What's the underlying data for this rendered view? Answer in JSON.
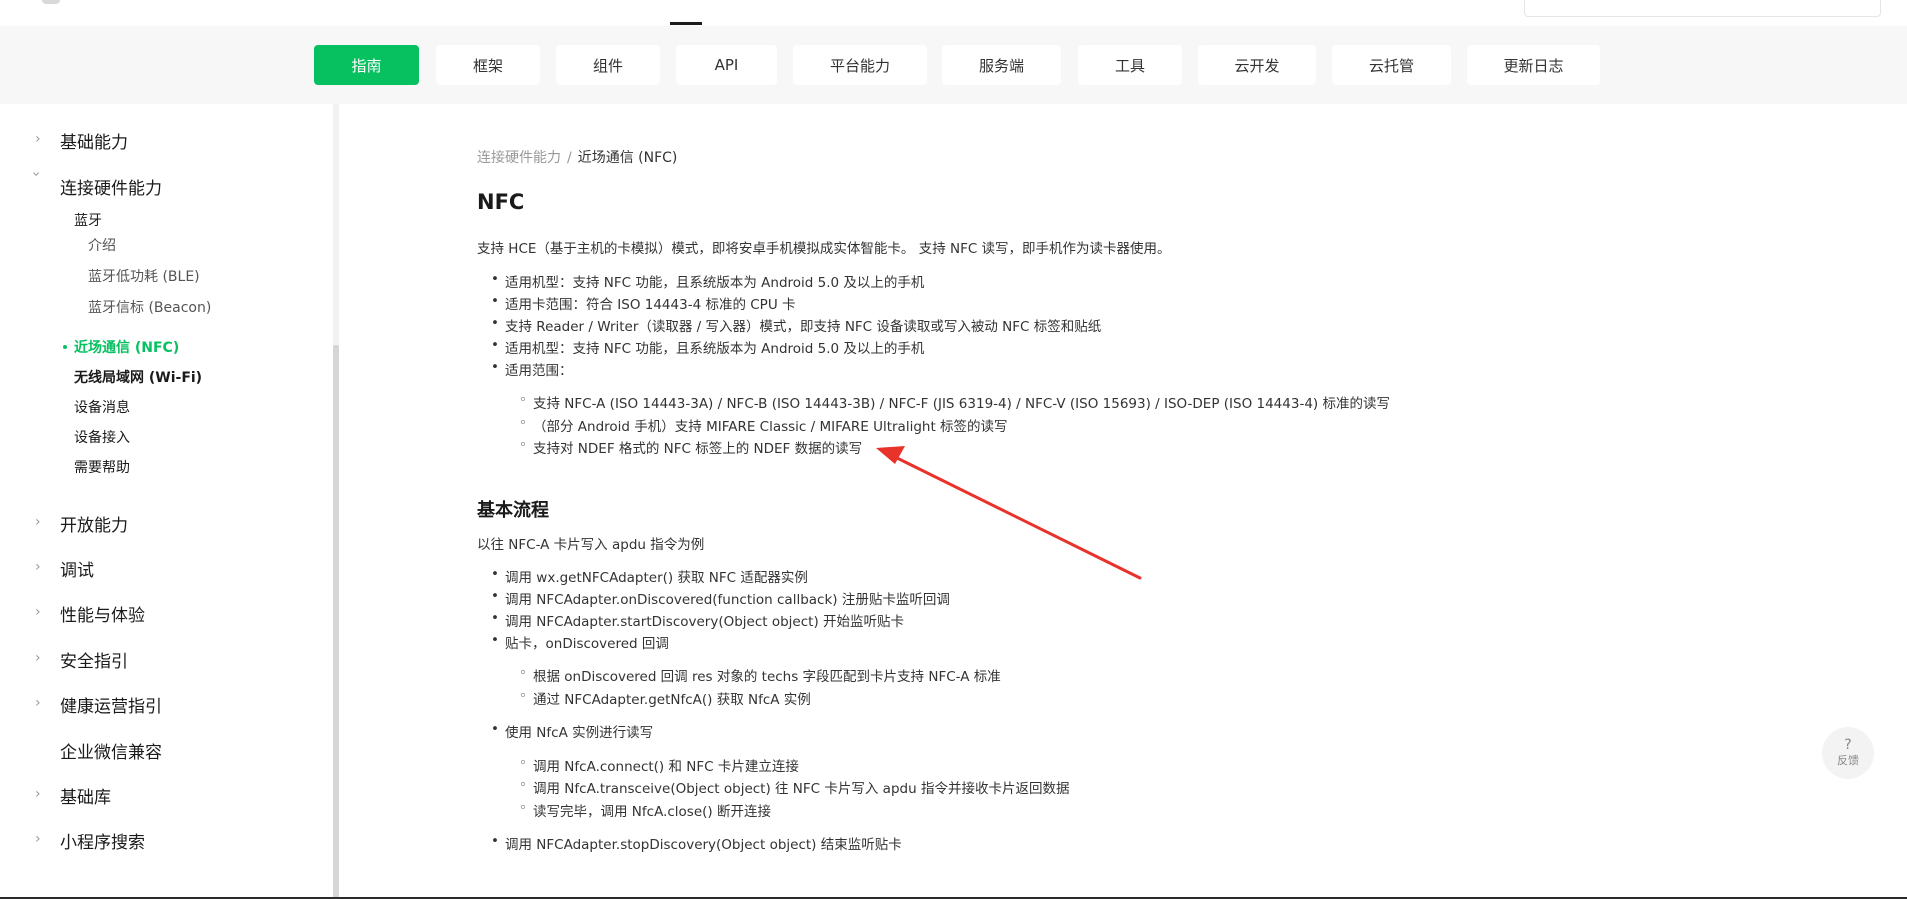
{
  "categories": [
    "指南",
    "框架",
    "组件",
    "API",
    "平台能力",
    "服务端",
    "工具",
    "云开发",
    "云托管",
    "更新日志"
  ],
  "sidebar": {
    "basic": "基础能力",
    "hardware": "连接硬件能力",
    "bluetooth": "蓝牙",
    "bt_intro": "介绍",
    "bt_ble": "蓝牙低功耗 (BLE)",
    "bt_beacon": "蓝牙信标 (Beacon)",
    "nfc": "近场通信 (NFC)",
    "wifi": "无线局域网 (Wi-Fi)",
    "device_msg": "设备消息",
    "device_access": "设备接入",
    "help": "需要帮助",
    "open": "开放能力",
    "debug": "调试",
    "perf": "性能与体验",
    "security": "安全指引",
    "health": "健康运营指引",
    "wecom": "企业微信兼容",
    "lib": "基础库",
    "search": "小程序搜索"
  },
  "breadcrumb": {
    "parent": "连接硬件能力",
    "separator": "/",
    "current": "近场通信 (NFC)"
  },
  "page": {
    "title": "NFC",
    "intro": "支持 HCE（基于主机的卡模拟）模式，即将安卓手机模拟成实体智能卡。 支持 NFC 读写，即手机作为读卡器使用。",
    "bullets": [
      "适用机型：支持 NFC 功能，且系统版本为 Android 5.0 及以上的手机",
      "适用卡范围：符合 ISO 14443-4 标准的 CPU 卡",
      "支持 Reader / Writer（读取器 / 写入器）模式，即支持 NFC 设备读取或写入被动 NFC 标签和贴纸",
      "适用机型：支持 NFC 功能，且系统版本为 Android 5.0 及以上的手机",
      "适用范围："
    ],
    "sub_bullets": [
      "支持 NFC-A (ISO 14443-3A) / NFC-B (ISO 14443-3B) / NFC-F (JIS 6319-4) / NFC-V (ISO 15693) / ISO-DEP (ISO 14443-4) 标准的读写",
      "（部分 Android 手机）支持 MIFARE Classic / MIFARE Ultralight 标签的读写",
      "支持对 NDEF 格式的 NFC 标签上的 NDEF 数据的读写"
    ],
    "flow_title": "基本流程",
    "flow_intro": "以往 NFC-A 卡片写入 apdu 指令为例",
    "flow": [
      "调用 wx.getNFCAdapter() 获取 NFC 适配器实例",
      "调用 NFCAdapter.onDiscovered(function callback) 注册贴卡监听回调",
      "调用 NFCAdapter.startDiscovery(Object object) 开始监听贴卡",
      "贴卡，onDiscovered 回调"
    ],
    "flow_sub1": [
      "根据 onDiscovered 回调 res 对象的 techs 字段匹配到卡片支持 NFC-A 标准",
      "通过 NFCAdapter.getNfcA() 获取 NfcA 实例"
    ],
    "flow5": "使用 NfcA 实例进行读写",
    "flow_sub2": [
      "调用 NfcA.connect() 和 NFC 卡片建立连接",
      "调用 NfcA.transceive(Object object) 往 NFC 卡片写入 apdu 指令并接收卡片返回数据",
      "读写完毕，调用 NfcA.close() 断开连接"
    ],
    "flow6": "调用 NFCAdapter.stopDiscovery(Object object) 结束监听贴卡"
  },
  "feedback": {
    "icon": "?",
    "label": "反馈"
  },
  "colors": {
    "accent": "#07c160",
    "annotation_arrow": "#e8322a",
    "nav_bg": "#f7f7f7"
  }
}
